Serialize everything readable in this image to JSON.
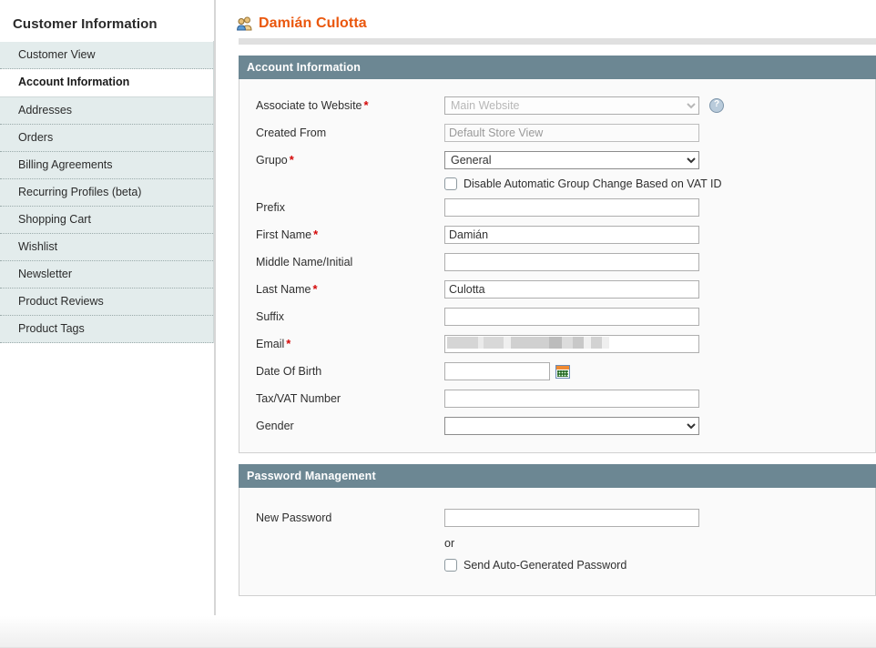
{
  "sidebar": {
    "title": "Customer Information",
    "items": [
      {
        "label": "Customer View",
        "active": false
      },
      {
        "label": "Account Information",
        "active": true
      },
      {
        "label": "Addresses",
        "active": false
      },
      {
        "label": "Orders",
        "active": false
      },
      {
        "label": "Billing Agreements",
        "active": false
      },
      {
        "label": "Recurring Profiles (beta)",
        "active": false
      },
      {
        "label": "Shopping Cart",
        "active": false
      },
      {
        "label": "Wishlist",
        "active": false
      },
      {
        "label": "Newsletter",
        "active": false
      },
      {
        "label": "Product Reviews",
        "active": false
      },
      {
        "label": "Product Tags",
        "active": false
      }
    ]
  },
  "header": {
    "title": "Damián Culotta",
    "icon": "customers-icon",
    "title_color": "#ea570d"
  },
  "account_section": {
    "title": "Account Information",
    "header_color": "#6c8793",
    "fields": {
      "associate_website": {
        "label": "Associate to Website",
        "required": true,
        "value": "Main Website",
        "disabled": true,
        "help_icon": "help-icon"
      },
      "created_from": {
        "label": "Created From",
        "required": false,
        "value": "Default Store View",
        "disabled": true
      },
      "grupo": {
        "label": "Grupo",
        "required": true,
        "value": "General",
        "options": [
          "General"
        ]
      },
      "disable_auto_group": {
        "label": "Disable Automatic Group Change Based on VAT ID",
        "checked": false
      },
      "prefix": {
        "label": "Prefix",
        "required": false,
        "value": ""
      },
      "first_name": {
        "label": "First Name",
        "required": true,
        "value": "Damián"
      },
      "middle_name": {
        "label": "Middle Name/Initial",
        "required": false,
        "value": ""
      },
      "last_name": {
        "label": "Last Name",
        "required": true,
        "value": "Culotta"
      },
      "suffix": {
        "label": "Suffix",
        "required": false,
        "value": ""
      },
      "email": {
        "label": "Email",
        "required": true,
        "value": "",
        "redacted": true
      },
      "date_of_birth": {
        "label": "Date Of Birth",
        "required": false,
        "value": "",
        "icon": "calendar-icon"
      },
      "tax_vat": {
        "label": "Tax/VAT Number",
        "required": false,
        "value": ""
      },
      "gender": {
        "label": "Gender",
        "required": false,
        "value": "",
        "options": [
          ""
        ]
      }
    }
  },
  "password_section": {
    "title": "Password Management",
    "header_color": "#6c8793",
    "new_password": {
      "label": "New Password",
      "value": ""
    },
    "or_text": "or",
    "auto_generated": {
      "label": "Send Auto-Generated Password",
      "checked": false
    }
  }
}
